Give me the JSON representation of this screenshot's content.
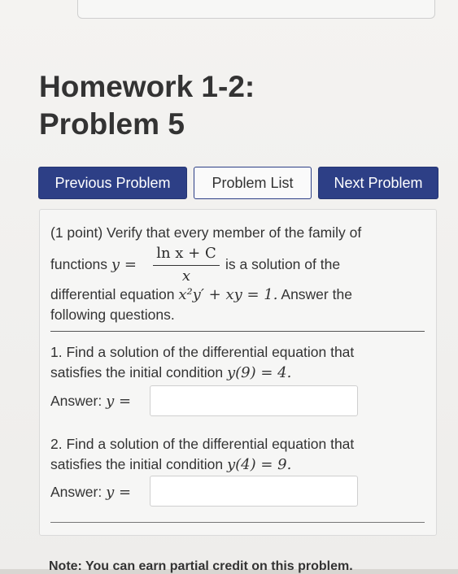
{
  "header": {
    "title_line1": "Homework 1-2:",
    "title_line2": "Problem 5"
  },
  "nav": {
    "previous": "Previous Problem",
    "list": "Problem List",
    "next": "Next Problem"
  },
  "problem": {
    "intro_line1": "(1 point) Verify that every member of the family of",
    "intro_functions": "functions",
    "y_equals": "y =",
    "fraction_numerator": "ln x + C",
    "fraction_denominator": "x",
    "intro_solution": "is a solution of the",
    "intro_line3_text": "differential equation",
    "equation": "x²y′ + xy = 1.",
    "intro_line3_tail": "Answer the",
    "intro_line4": "following questions.",
    "q1_line1": "1. Find a solution of the differential equation that",
    "q1_line2_text": "satisfies the initial condition",
    "q1_condition": "y(9) = 4.",
    "q1_answer_label": "Answer:",
    "q1_answer_var": "y =",
    "q1_answer_value": "",
    "q2_line1": "2. Find a solution of the differential equation that",
    "q2_line2_text": "satisfies the initial condition",
    "q2_condition": "y(4) = 9.",
    "q2_answer_label": "Answer:",
    "q2_answer_var": "y =",
    "q2_answer_value": ""
  },
  "footer": {
    "cut_text": "Note: You can earn partial credit on this problem."
  },
  "colors": {
    "primary": "#2d3f86",
    "background": "#f4f3f1"
  }
}
